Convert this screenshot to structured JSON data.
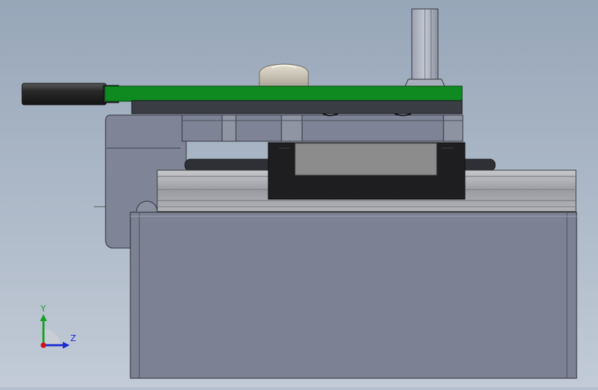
{
  "viewport": {
    "background_top": "#97a6b8",
    "background_bottom": "#c2cbd7"
  },
  "colors": {
    "pcb_green": "#0f8a20",
    "pcb_dark": "#3b3d45",
    "housing": "#7c8193",
    "rail": "#9b9da3",
    "carriage": "#1e1e20",
    "carriage_insert": "#8c8c8c",
    "axis_y": "#14a01e",
    "axis_z": "#1a2bd0",
    "axis_x": "#d0141e"
  },
  "triad": {
    "y_label": "Y",
    "z_label": "Z",
    "y_icon": "arrow-up-icon",
    "z_icon": "arrow-right-icon",
    "origin_icon": "origin-dot-icon"
  }
}
